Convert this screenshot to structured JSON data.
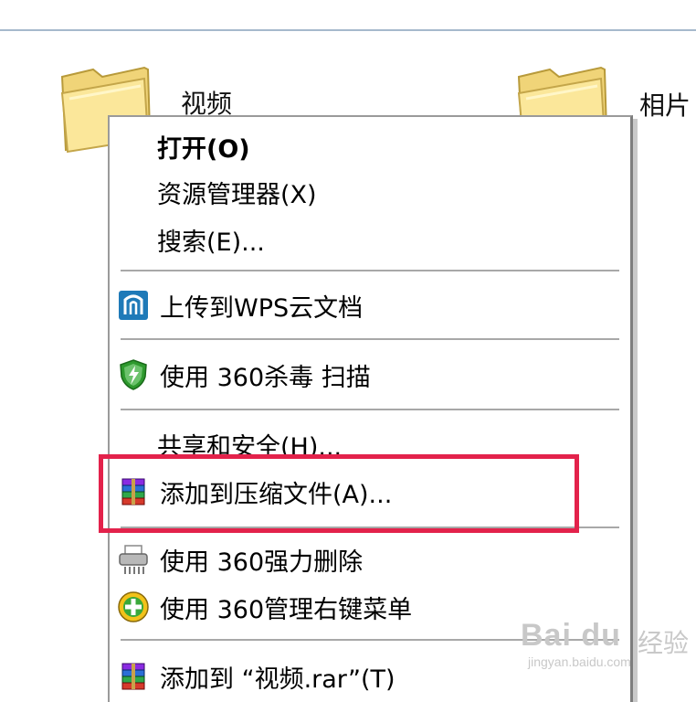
{
  "desktop": {
    "folders": [
      {
        "label": "视频"
      },
      {
        "label": "相片"
      }
    ]
  },
  "context_menu": {
    "items": [
      {
        "label": "打开(O)"
      },
      {
        "label": "资源管理器(X)"
      },
      {
        "label": "搜索(E)..."
      },
      {
        "label": "上传到WPS云文档"
      },
      {
        "label": "使用 360杀毒 扫描"
      },
      {
        "label": "共享和安全(H)..."
      },
      {
        "label": "添加到压缩文件(A)..."
      },
      {
        "label": "使用 360强力删除"
      },
      {
        "label": "使用 360管理右键菜单"
      },
      {
        "label": "添加到 “视频.rar”(T)"
      }
    ]
  },
  "annotation": {
    "highlight_color": "#e3224b"
  },
  "watermark": {
    "brand": "Bai du",
    "cn": "经验",
    "url": "jingyan.baidu.com"
  }
}
